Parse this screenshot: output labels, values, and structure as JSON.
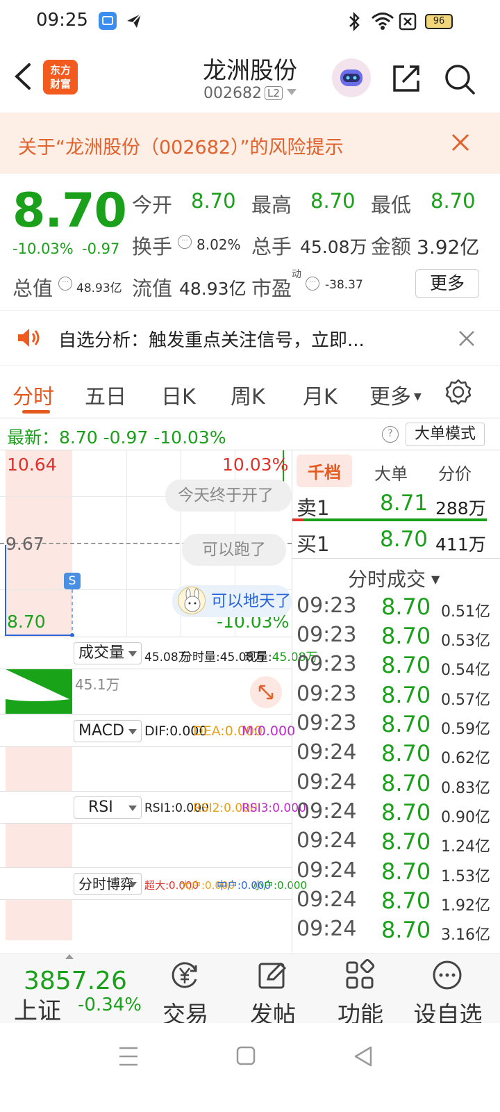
{
  "status_bar": {
    "time": "09:25",
    "battery": "96"
  },
  "header": {
    "logo_line1": "东方",
    "logo_line2": "财富",
    "stock_name": "龙洲股份",
    "stock_code": "002682",
    "level_tag": "L2"
  },
  "risk_banner": {
    "text": "关于“龙洲股份（002682）”的风险提示"
  },
  "quote": {
    "price": "8.70",
    "change_pct": "-10.03%",
    "change": "-0.97",
    "open_label": "今开",
    "open": "8.70",
    "high_label": "最高",
    "high": "8.70",
    "low_label": "最低",
    "low": "8.70",
    "turnover_label": "换手",
    "turnover": "8.02%",
    "volume_label": "总手",
    "volume": "45.08万",
    "amount_label": "金额",
    "amount": "3.92亿",
    "mktcap_label": "总值",
    "mktcap": "48.93亿",
    "float_label": "流值",
    "float": "48.93亿",
    "pe_label": "市盈",
    "pe_sup": "动",
    "pe": "-38.37",
    "more_label": "更多"
  },
  "ticker": {
    "text": "自选分析：触发重点关注信号，立即..."
  },
  "tabs": [
    "分时",
    "五日",
    "日K",
    "周K",
    "月K",
    "更多"
  ],
  "latest": {
    "text": "最新：8.70  -0.97  -10.03%",
    "mode_button": "大单模式",
    "help": "?"
  },
  "chart": {
    "y_top": "10.64",
    "y_top_pct": "10.03%",
    "y_mid": "9.67",
    "y_bottom": "8.70",
    "y_bottom_pct": "-10.03%",
    "badge_s": "S",
    "comments": [
      "今天终于开了",
      "可以跑了",
      "可以地天了"
    ],
    "volume_selector": "成交量",
    "volume_stats": {
      "total": "45.08万",
      "segment_label": "分时量:",
      "segment": "45.08万",
      "current_label": "现量:",
      "current": "45.08万"
    },
    "volume_axis": "45.1万",
    "macd_selector": "MACD",
    "macd": {
      "dif": "DIF:0.000",
      "dea": "DEA:0.000",
      "m": "M:0.000"
    },
    "rsi_selector": "RSI",
    "rsi": {
      "r1": "RSI1:0.000",
      "r2": "RSI2:0.000",
      "r3": "RSI3:0.000"
    },
    "flow_selector": "分时博弈",
    "flow": {
      "super": "超大:0.000",
      "large": "大户:0.000",
      "medium": "中户:0.000",
      "small": "小户:0.000"
    },
    "colors": {
      "up": "#e0302a",
      "down": "#1aa01a",
      "accent": "#e45a1e"
    }
  },
  "order_book": {
    "tabs": [
      "千档",
      "大单",
      "分价"
    ],
    "sell1_label": "卖1",
    "sell1_price": "8.71",
    "sell1_vol": "288万",
    "buy1_label": "买1",
    "buy1_price": "8.70",
    "buy1_vol": "411万",
    "trades_title": "分时成交",
    "trades": [
      {
        "time": "09:23",
        "price": "8.70",
        "amount": "0.51亿"
      },
      {
        "time": "09:23",
        "price": "8.70",
        "amount": "0.53亿"
      },
      {
        "time": "09:23",
        "price": "8.70",
        "amount": "0.54亿"
      },
      {
        "time": "09:23",
        "price": "8.70",
        "amount": "0.57亿"
      },
      {
        "time": "09:23",
        "price": "8.70",
        "amount": "0.59亿"
      },
      {
        "time": "09:24",
        "price": "8.70",
        "amount": "0.62亿"
      },
      {
        "time": "09:24",
        "price": "8.70",
        "amount": "0.83亿"
      },
      {
        "time": "09:24",
        "price": "8.70",
        "amount": "0.90亿"
      },
      {
        "time": "09:24",
        "price": "8.70",
        "amount": "1.24亿"
      },
      {
        "time": "09:24",
        "price": "8.70",
        "amount": "1.53亿"
      },
      {
        "time": "09:24",
        "price": "8.70",
        "amount": "1.92亿"
      },
      {
        "time": "09:24",
        "price": "8.70",
        "amount": "3.16亿"
      }
    ]
  },
  "bottom_bar": {
    "index_value": "3857.26",
    "index_name": "上证",
    "index_change": "-0.34%",
    "nav": [
      "交易",
      "发帖",
      "功能",
      "设自选"
    ]
  }
}
